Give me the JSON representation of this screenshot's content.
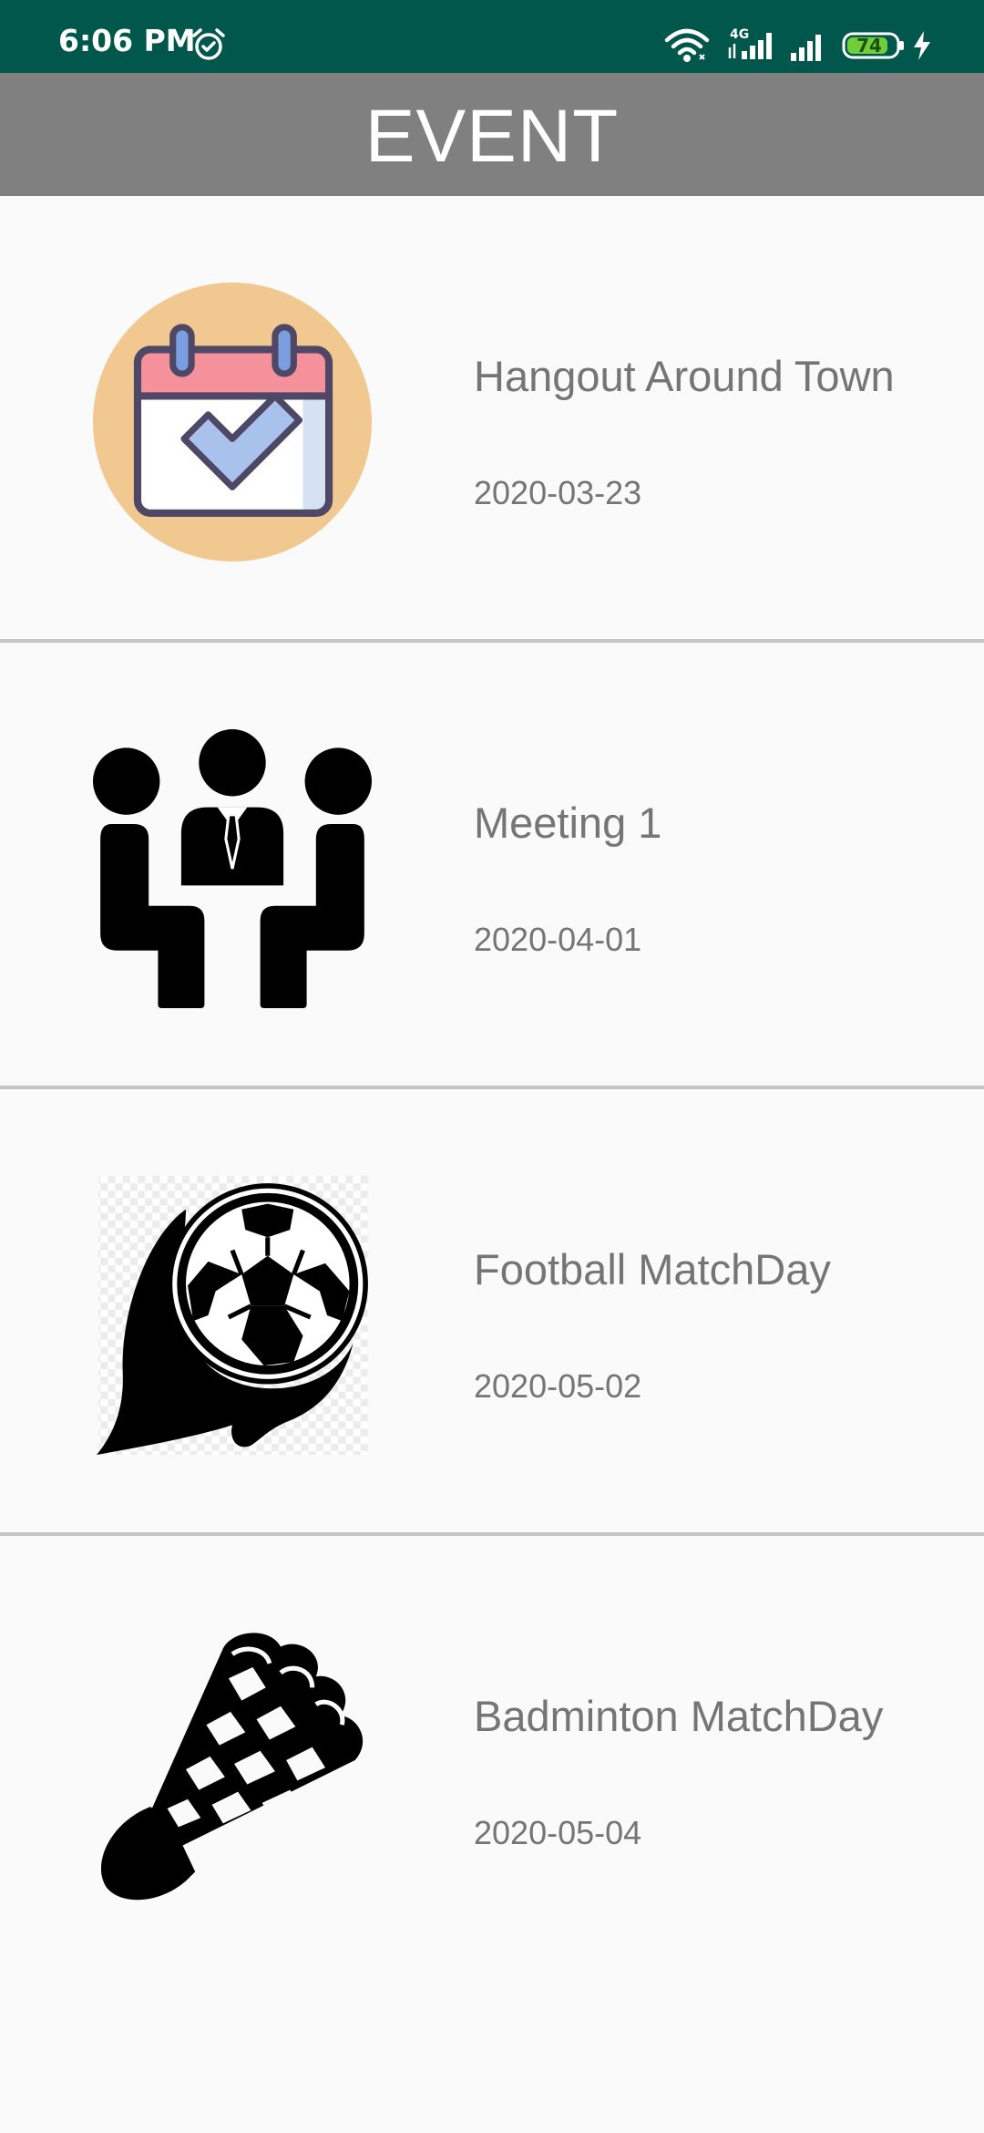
{
  "status_bar": {
    "time": "6:06 PM",
    "battery_level": "74",
    "network_type": "4G",
    "background_color": "#01574b",
    "icons": [
      "alarm-icon",
      "wifi-icon",
      "cell-signal-icon",
      "cell-signal-icon",
      "battery-icon",
      "charging-icon"
    ]
  },
  "app_bar": {
    "title": "EVENT",
    "background_color": "#808080"
  },
  "events": [
    {
      "title": "Hangout Around Town",
      "date": "2020-03-23",
      "icon": "calendar-check-icon"
    },
    {
      "title": "Meeting 1",
      "date": "2020-04-01",
      "icon": "meeting-icon"
    },
    {
      "title": "Football MatchDay",
      "date": "2020-05-02",
      "icon": "football-icon"
    },
    {
      "title": "Badminton MatchDay",
      "date": "2020-05-04",
      "icon": "shuttlecock-icon"
    }
  ],
  "colors": {
    "text_gray": "#757575",
    "divider": "#c4c4c4",
    "page_background": "#fafafa"
  }
}
